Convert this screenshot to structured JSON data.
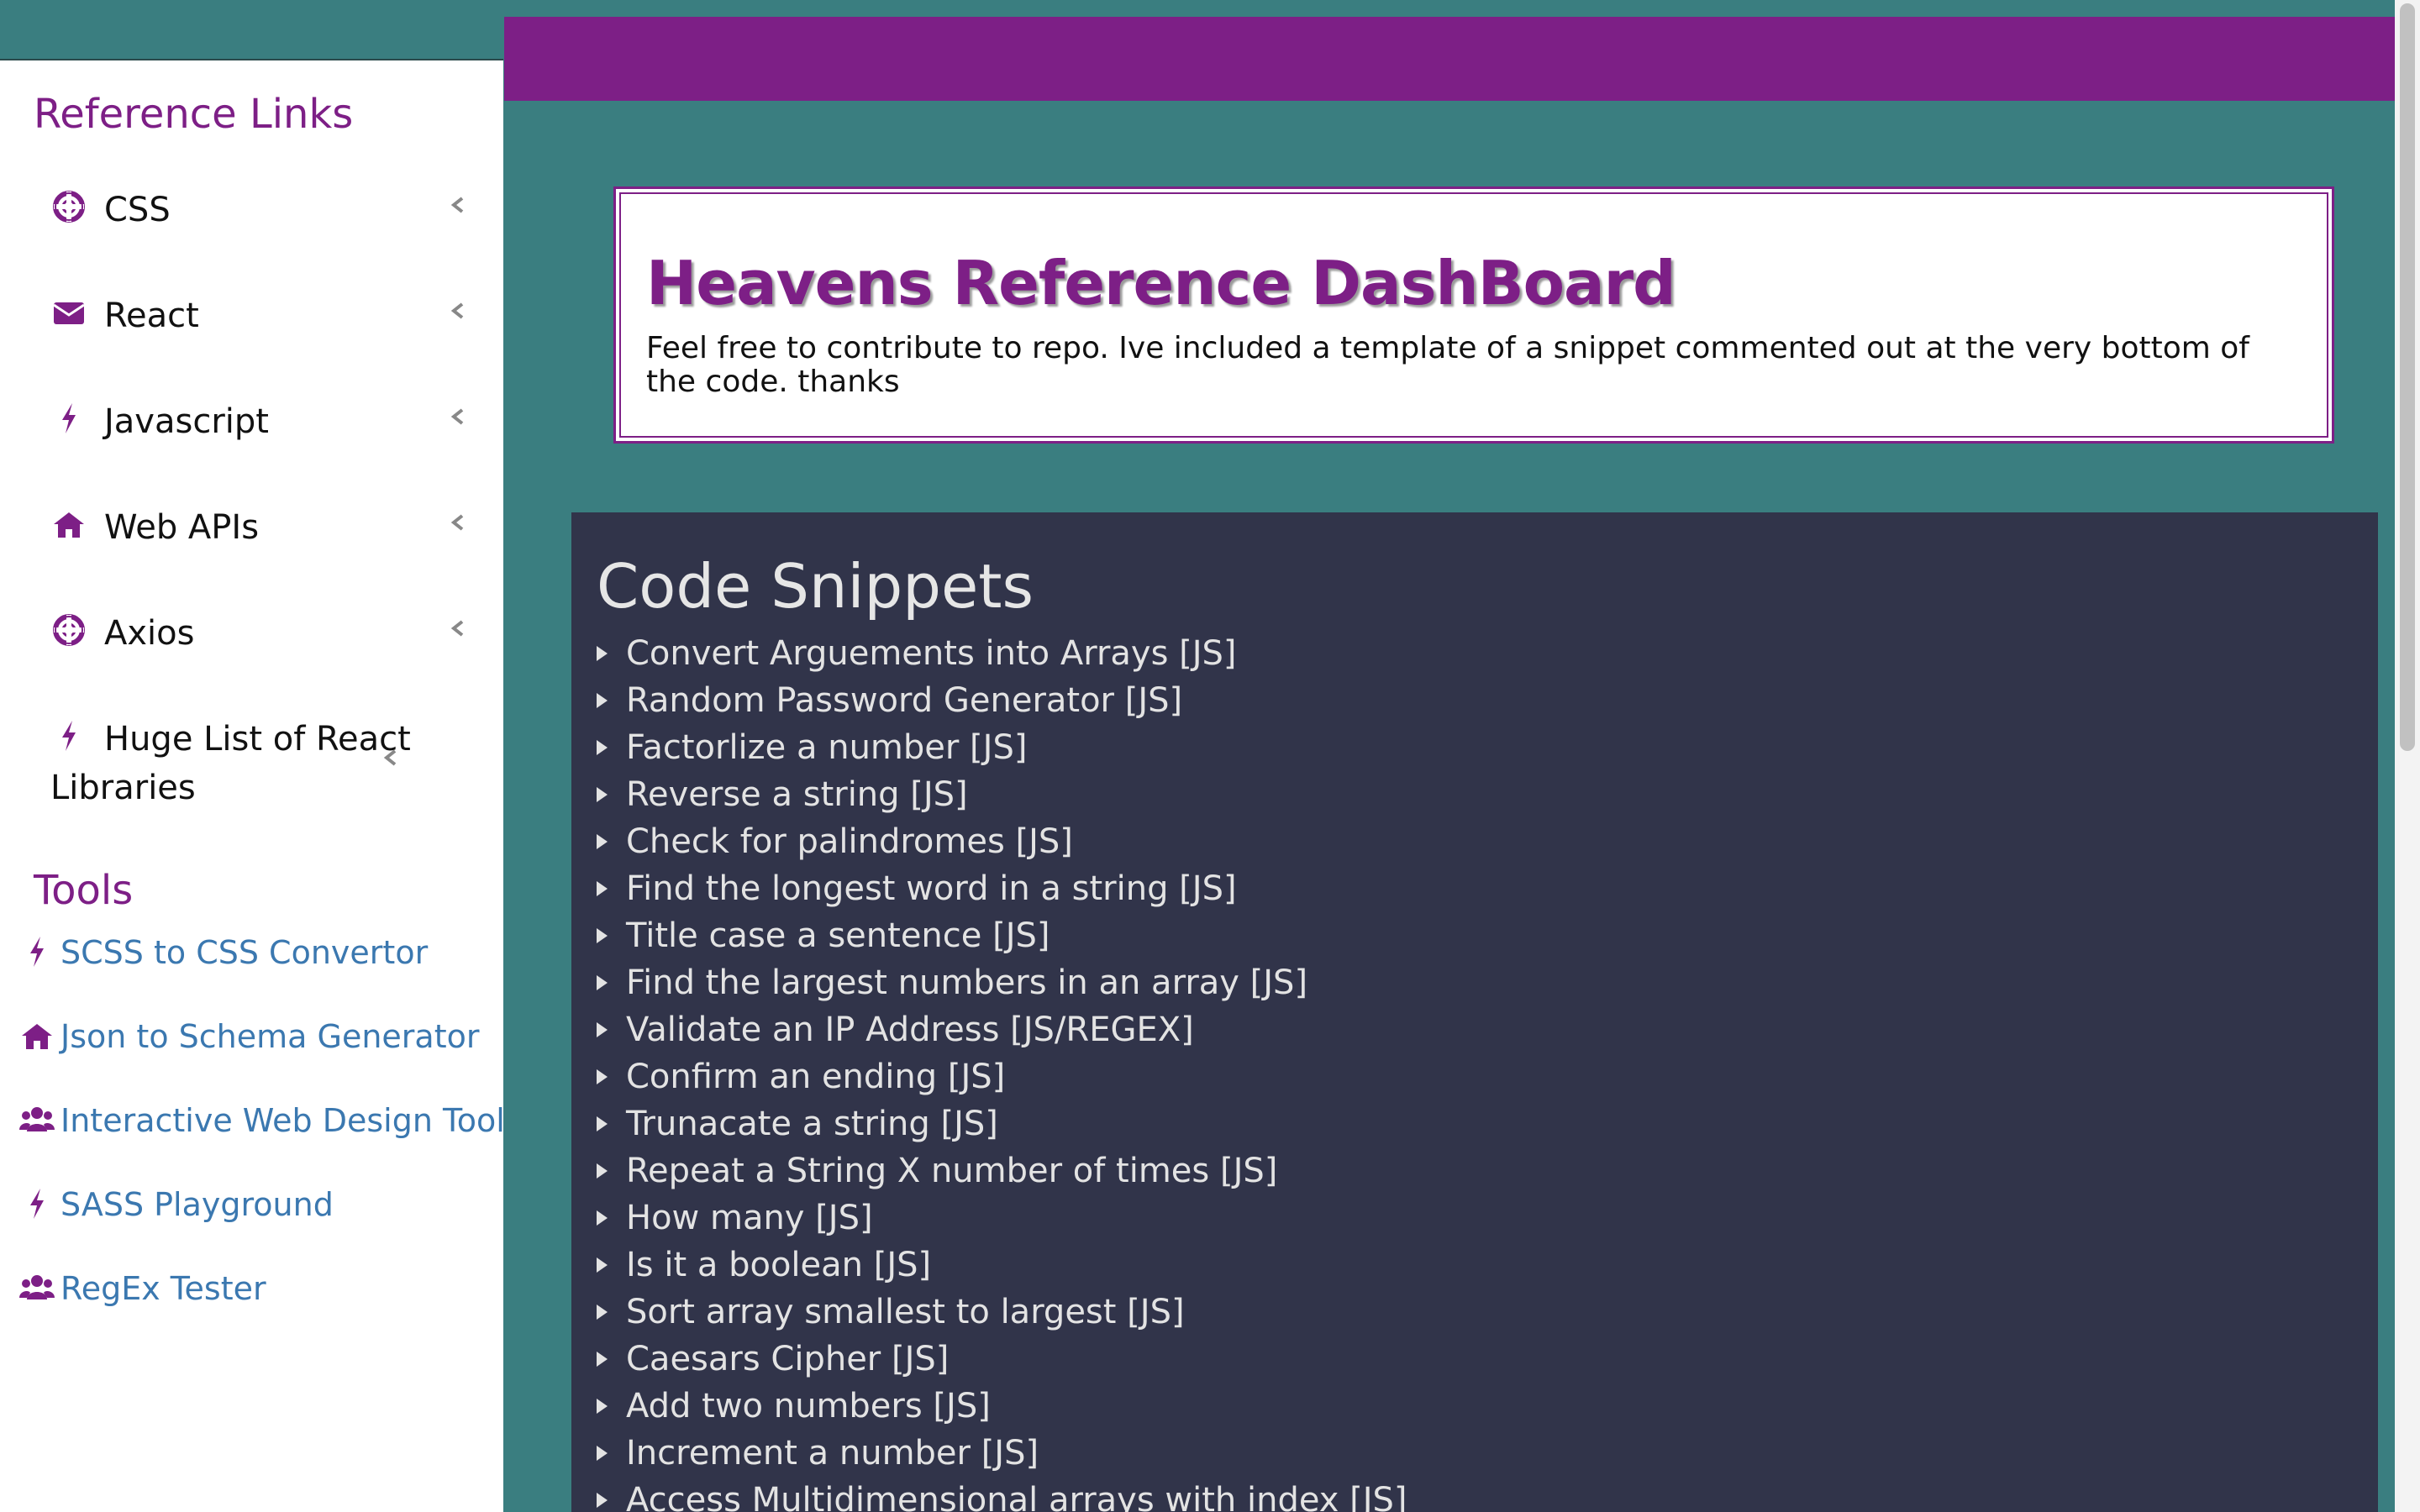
{
  "sidebar": {
    "reference_heading": "Reference Links",
    "reference_items": [
      {
        "label": "CSS",
        "icon": "life-ring-icon"
      },
      {
        "label": "React",
        "icon": "envelope-icon"
      },
      {
        "label": "Javascript",
        "icon": "bolt-icon"
      },
      {
        "label": "Web APIs",
        "icon": "home-icon"
      },
      {
        "label": "Axios",
        "icon": "life-ring-icon"
      },
      {
        "label": "Huge List of React Libraries",
        "icon": "bolt-icon"
      }
    ],
    "tools_heading": "Tools",
    "tools": [
      {
        "label": "SCSS to CSS Convertor",
        "icon": "bolt-icon"
      },
      {
        "label": "Json to Schema Generator",
        "icon": "home-icon"
      },
      {
        "label": "Interactive Web Design Tool",
        "icon": "users-icon"
      },
      {
        "label": "SASS Playground",
        "icon": "bolt-icon"
      },
      {
        "label": "RegEx Tester",
        "icon": "users-icon"
      }
    ]
  },
  "header": {
    "title": "Heavens Reference DashBoard",
    "description": "Feel free to contribute to repo. Ive included a template of a snippet commented out at the very bottom of the code. thanks"
  },
  "snippets": {
    "title": "Code Snippets",
    "items": [
      "Convert Arguements into Arrays [JS]",
      "Random Password Generator [JS]",
      "Factorlize a number [JS]",
      "Reverse a string [JS]",
      "Check for palindromes [JS]",
      "Find the longest word in a string [JS]",
      "Title case a sentence [JS]",
      "Find the largest numbers in an array [JS]",
      "Validate an IP Address [JS/REGEX]",
      "Confirm an ending [JS]",
      "Trunacate a string [JS]",
      "Repeat a String X number of times [JS]",
      "How many [JS]",
      "Is it a boolean [JS]",
      "Sort array smallest to largest [JS]",
      "Caesars Cipher [JS]",
      "Add two numbers [JS]",
      "Increment a number [JS]",
      "Access Multidimensional arrays with index [JS]"
    ]
  },
  "colors": {
    "accent": "#7d1f86",
    "background": "#3a7e80",
    "panel": "#31344a",
    "link": "#3b78b0"
  }
}
